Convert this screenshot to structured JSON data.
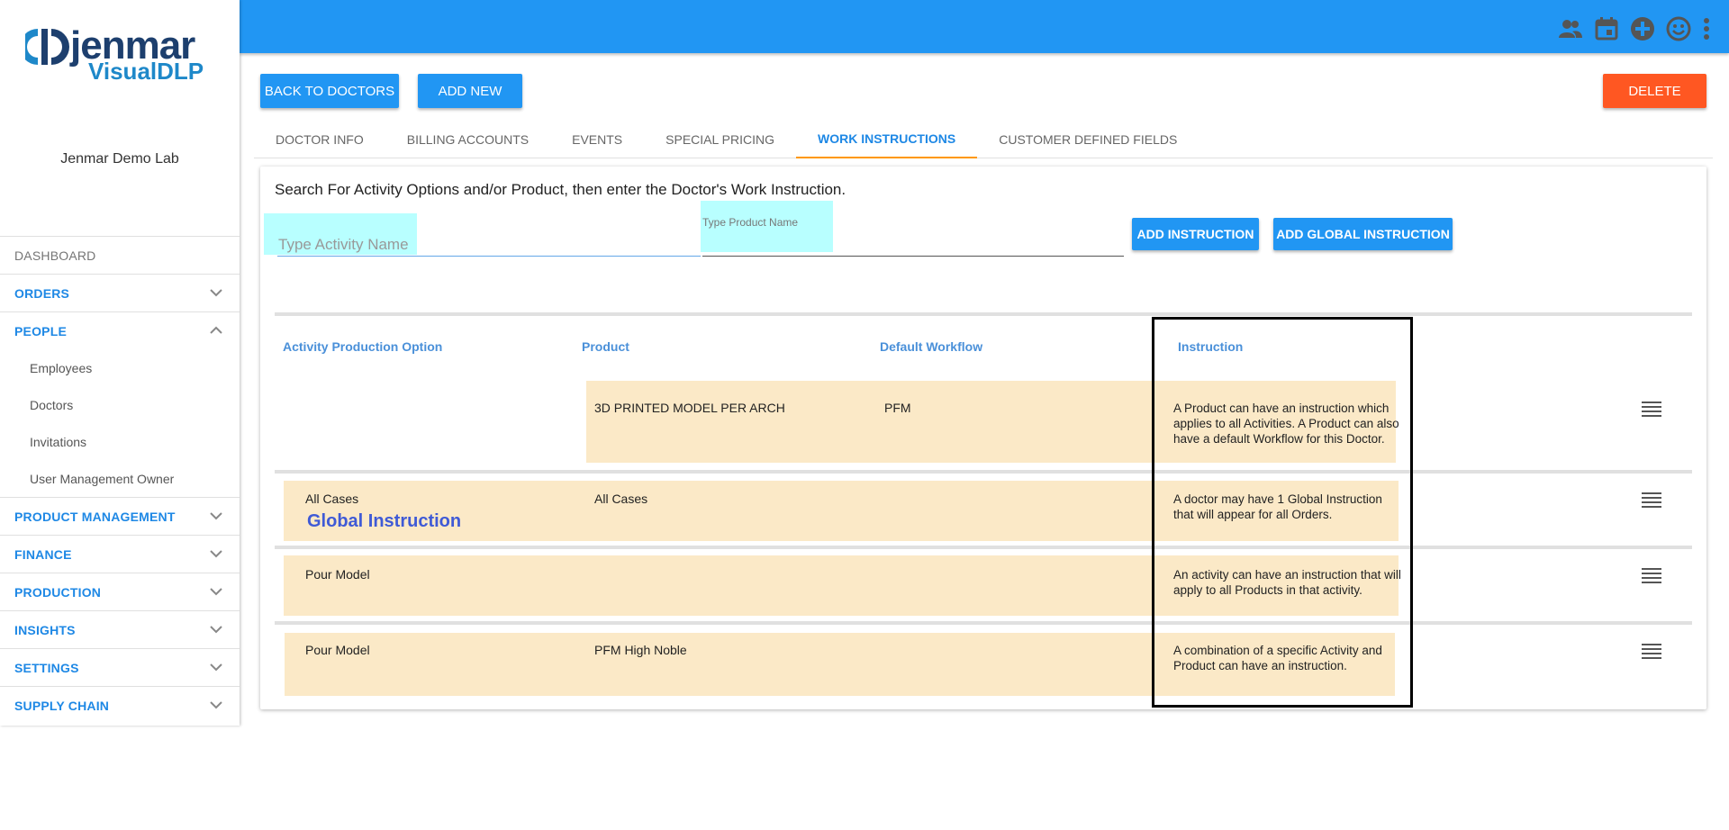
{
  "brand": {
    "name": "jenmar",
    "product": "VisualDLP",
    "lab": "Jenmar Demo Lab"
  },
  "sidebar": {
    "items": [
      {
        "label": "DASHBOARD"
      },
      {
        "label": "ORDERS"
      },
      {
        "label": "PEOPLE"
      },
      {
        "label": "Employees"
      },
      {
        "label": "Doctors"
      },
      {
        "label": "Invitations"
      },
      {
        "label": "User Management Owner"
      },
      {
        "label": "PRODUCT MANAGEMENT"
      },
      {
        "label": "FINANCE"
      },
      {
        "label": "PRODUCTION"
      },
      {
        "label": "INSIGHTS"
      },
      {
        "label": "SETTINGS"
      },
      {
        "label": "SUPPLY CHAIN"
      }
    ]
  },
  "topbar": {
    "icons": [
      "people-icon",
      "calendar-icon",
      "add-circle-icon",
      "smiley-icon",
      "more-vert-icon"
    ]
  },
  "actions": {
    "back": "BACK TO DOCTORS",
    "add_new": "ADD NEW",
    "delete": "DELETE"
  },
  "tabs": [
    {
      "label": "DOCTOR INFO"
    },
    {
      "label": "BILLING ACCOUNTS"
    },
    {
      "label": "EVENTS"
    },
    {
      "label": "SPECIAL PRICING"
    },
    {
      "label": "WORK INSTRUCTIONS"
    },
    {
      "label": "CUSTOMER DEFINED FIELDS"
    }
  ],
  "work": {
    "intro": "Search For Activity Options and/or Product, then enter the Doctor's Work Instruction.",
    "activity_placeholder": "Type Activity Name",
    "product_placeholder": "Type Product Name",
    "add_instruction": "ADD INSTRUCTION",
    "add_global_instruction": "ADD GLOBAL INSTRUCTION",
    "headers": {
      "activity": "Activity Production Option",
      "product": "Product",
      "workflow": "Default Workflow",
      "instruction": "Instruction"
    },
    "rows": [
      {
        "activity": "",
        "product": "3D PRINTED MODEL PER ARCH",
        "workflow": "PFM",
        "instruction": "A Product can have an instruction which applies to all Activities. A Product can also have a default Workflow for this Doctor."
      },
      {
        "activity": "All Cases",
        "product": "All Cases",
        "workflow": "",
        "instruction": "A doctor may have 1 Global Instruction that will appear for all Orders.",
        "note": "Global Instruction"
      },
      {
        "activity": "Pour Model",
        "product": "",
        "workflow": "",
        "instruction": "An activity can have an instruction that will apply to all Products in that activity."
      },
      {
        "activity": "Pour Model",
        "product": "PFM High Noble",
        "workflow": "",
        "instruction": "A combination of a specific Activity and Product can have an instruction."
      }
    ]
  },
  "colors": {
    "primary": "#2196f3",
    "danger": "#ff5722",
    "tab_indicator": "#ff9800",
    "row_highlight": "#fbe9c7",
    "field_highlight": "#b8ffff"
  }
}
